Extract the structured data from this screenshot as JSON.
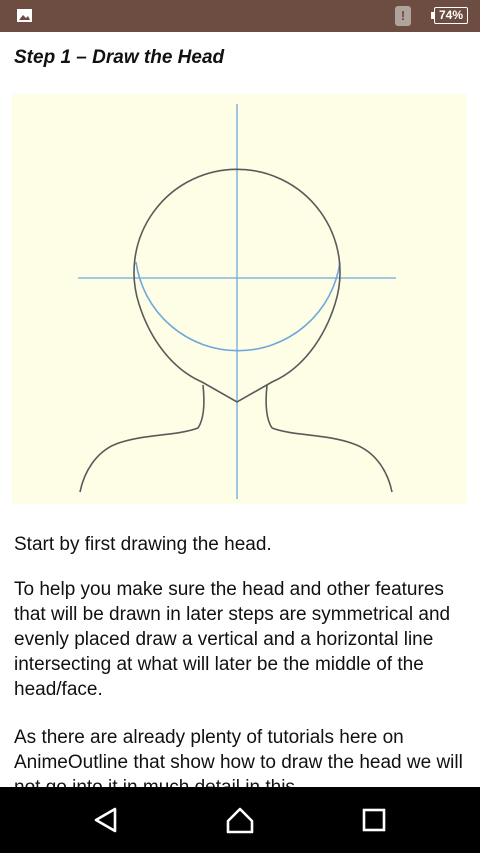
{
  "status_bar": {
    "battery_percent": "74%",
    "alert_symbol": "!"
  },
  "article": {
    "title": "Step 1 – Draw the Head",
    "paragraphs": [
      "Start by first drawing the head.",
      "To help you make sure the head and other features that will be drawn in later steps are symmetrical and evenly placed draw a vertical and a horizontal line intersecting at what will later be the middle of the head/face.",
      "As there are already plenty of tutorials here on AnimeOutline that show how to draw the head we will not go into it in much detail in this"
    ]
  },
  "colors": {
    "status_bar": "#6d4c41",
    "figure_background": "#fefde6",
    "guide_line": "#6fa8dc",
    "outline": "#555555",
    "nav_bar": "#000000"
  },
  "icons": {
    "status_left": "gallery-icon",
    "status_alert": "alert-icon",
    "status_battery": "battery-icon",
    "nav_back": "back-triangle-icon",
    "nav_home": "home-icon",
    "nav_recents": "recents-square-icon"
  }
}
